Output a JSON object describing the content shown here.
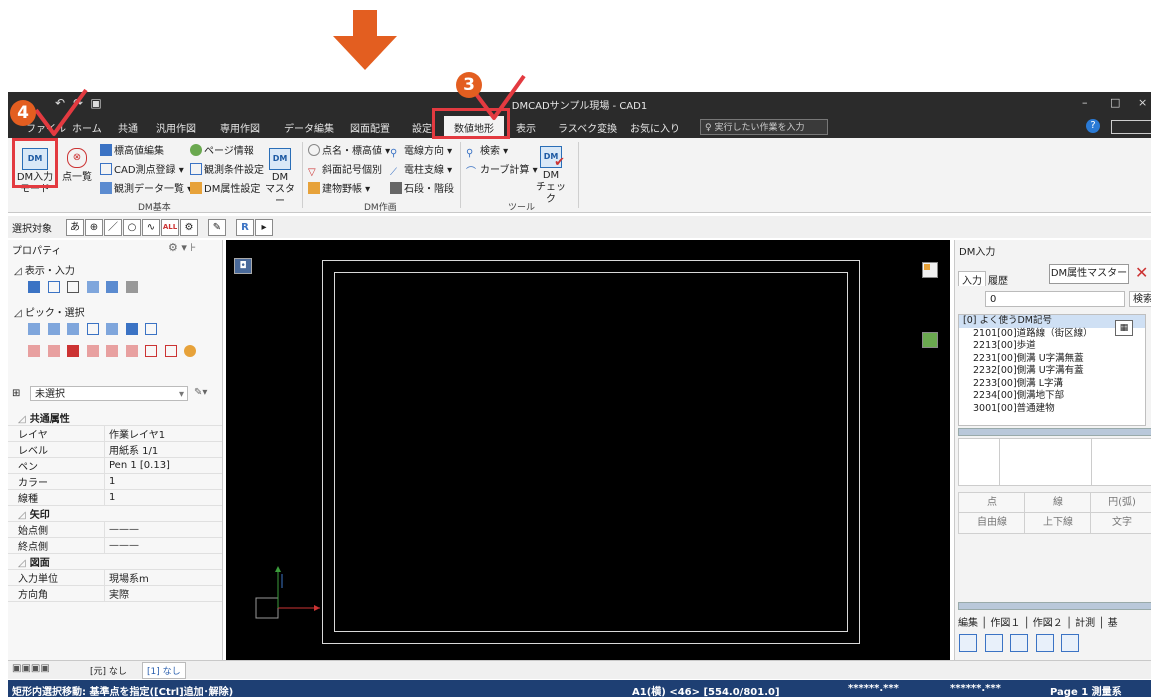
{
  "annotations": {
    "step3": "3",
    "step4": "4"
  },
  "titlebar": {
    "title": "DMCADサンプル現場 - CAD1",
    "minimize": "–",
    "maximize": "□",
    "close": "×"
  },
  "tabs": [
    "ファイル",
    "ホーム",
    "共通",
    "汎用作図",
    "専用作図",
    "データ編集",
    "図面配置",
    "設定",
    "数値地形",
    "表示",
    "ラスベク変換",
    "お気に入り"
  ],
  "tell_me": "実行したい作業を入力",
  "help": "?",
  "ribbon": {
    "dm_input_line1": "DM入力",
    "dm_input_line2": "モード",
    "dm_big_icon": "DM",
    "point_list": "点一覧",
    "elev_edit": "標高値編集",
    "cad_reg": "CAD測点登録",
    "obs_list": "観測データ一覧",
    "page_info": "ページ情報",
    "obs_cond": "観測条件設定",
    "dm_attr": "DM属性設定",
    "dm_master_1": "DM",
    "dm_master_2": "マスター",
    "name_elev": "点名・標高値",
    "elec_dir": "電線方向",
    "slope_sym": "斜面記号個別",
    "pole": "電柱支線",
    "building": "建物野帳",
    "stone": "石段・階段",
    "search": "検索",
    "curve": "カーブ計算",
    "dm_check_1": "DM",
    "dm_check_2": "チェック",
    "group_basic": "DM基本",
    "group_draw": "DM作画",
    "group_tool": "ツール"
  },
  "selrow": {
    "label": "選択対象",
    "buttons": [
      "あ",
      "⊕",
      "／",
      "○",
      "∿",
      "ALL",
      "⚙",
      "✎",
      "R",
      "▸"
    ]
  },
  "properties": {
    "title": "プロパティ",
    "sec_display": "表示・入力",
    "sec_pick": "ピック・選択",
    "selection": "未選択",
    "rows": [
      {
        "type": "sec",
        "label": "共通属性"
      },
      {
        "label": "レイヤ",
        "value": "作業レイヤ1"
      },
      {
        "label": "レベル",
        "value": "用紙系 1/1"
      },
      {
        "label": "ペン",
        "value": "Pen 1 [0.13]"
      },
      {
        "label": "カラー",
        "value": "1"
      },
      {
        "label": "線種",
        "value": "1"
      },
      {
        "type": "sec",
        "label": "矢印"
      },
      {
        "label": "始点側",
        "value": "———"
      },
      {
        "label": "終点側",
        "value": "———"
      },
      {
        "type": "sec",
        "label": "図面"
      },
      {
        "label": "入力単位",
        "value": "現場系m"
      },
      {
        "label": "方向角",
        "value": "実際"
      }
    ]
  },
  "dm_panel": {
    "title": "DM入力",
    "tab_input": "入力",
    "tab_history": "履歴",
    "attr_master_btn": "DM属性マスター",
    "code_value": "0",
    "search_btn": "検索",
    "list": [
      "[0] よく使うDM記号",
      "2101[00]道路線（街区線）",
      "2213[00]歩道",
      "2231[00]側溝 U字溝無蓋",
      "2232[00]側溝 U字溝有蓋",
      "2233[00]側溝 L字溝",
      "2234[00]側溝地下部",
      "3001[00]普通建物"
    ],
    "btn_point": "点",
    "btn_line": "線",
    "btn_arc": "円(弧)",
    "btn_free": "自由線",
    "btn_updown": "上下線",
    "btn_text": "文字",
    "bottom_tabs": [
      "編集",
      "作図１",
      "作図２",
      "計測",
      "基"
    ]
  },
  "bottom_tabs": [
    "[元] なし",
    "[1] なし"
  ],
  "status": {
    "message": "矩形内選択移動: 基準点を指定([Ctrl]追加･解除)",
    "paper": "A1(横) <46> [554.0/801.0]",
    "x": "******.***",
    "y": "******.***",
    "page": "Page  1  測量系"
  },
  "colors": {
    "accent": "#e35e20",
    "status_bg": "#1e3f73",
    "titlebar": "#2b2b2b",
    "callout_box": "#e33a40"
  }
}
